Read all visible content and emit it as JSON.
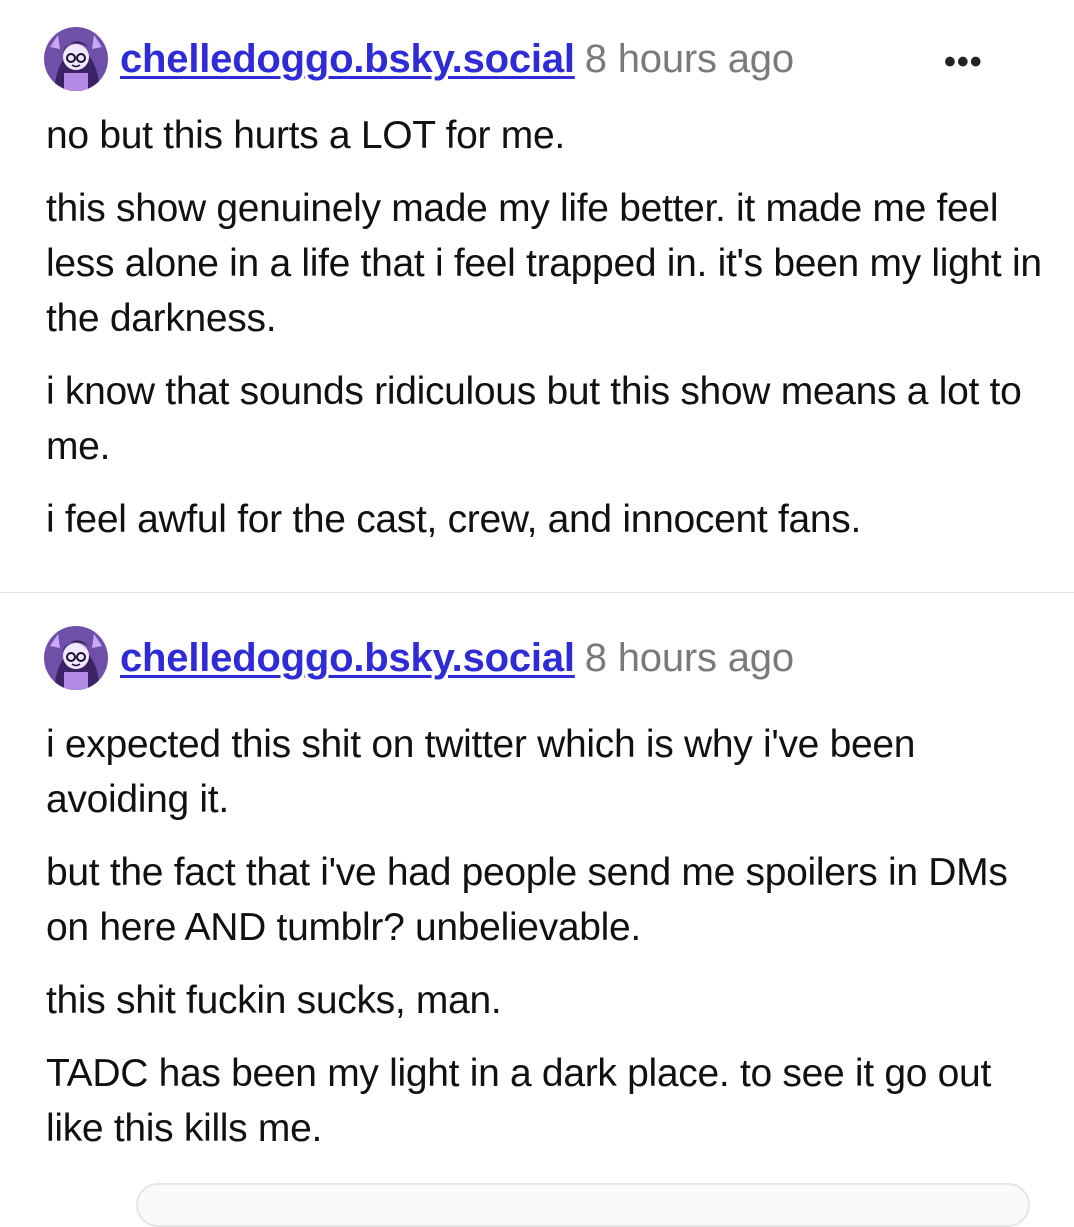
{
  "posts": [
    {
      "username": "chelledoggo.bsky.social",
      "time": "8 hours ago",
      "more_label": "•••",
      "paragraphs": [
        "no but this hurts a LOT for me.",
        "this show genuinely made my life better. it made me feel less alone in a life that i feel trapped in. it's been my light in the darkness.",
        "i know that sounds ridiculous but this show means a lot to me.",
        "i feel awful for the cast, crew, and innocent fans."
      ]
    },
    {
      "username": "chelledoggo.bsky.social",
      "time": "8 hours ago",
      "paragraphs": [
        "i expected this shit on twitter which is why i've been avoiding it.",
        "but the fact that i've had people send me spoilers in DMs on here AND tumblr? unbelievable.",
        "this shit fuckin sucks, man.",
        "TADC has been my light in a dark place. to see it go out like this kills me."
      ]
    }
  ],
  "colors": {
    "username": "#2f2bd6",
    "timestamp": "#7a7a7a",
    "avatar_bg": "#6f4fa8"
  }
}
